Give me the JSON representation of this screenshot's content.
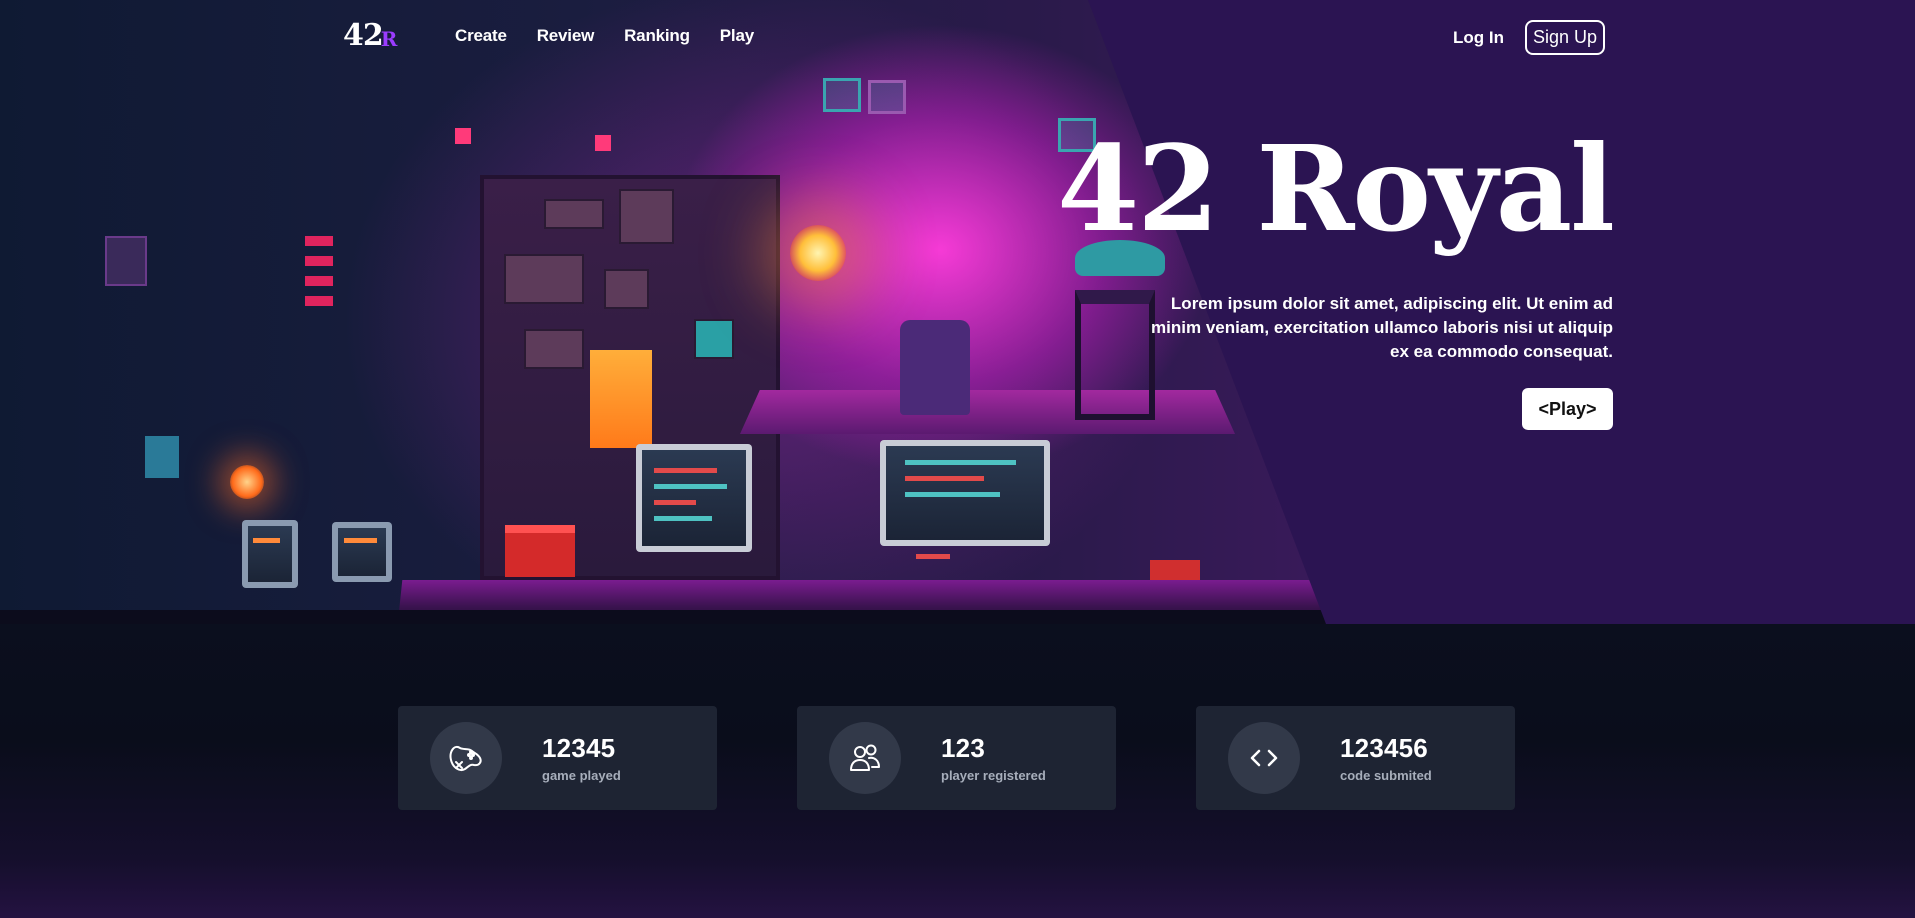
{
  "brand": {
    "logo_number": "42",
    "logo_letter": "R"
  },
  "nav": {
    "items": [
      {
        "label": "Create"
      },
      {
        "label": "Review"
      },
      {
        "label": "Ranking"
      },
      {
        "label": "Play"
      }
    ],
    "login_label": "Log In",
    "signup_label": "Sign Up"
  },
  "hero": {
    "title": "42 Royal",
    "description": "Lorem ipsum dolor sit amet, adipiscing elit. Ut enim ad minim veniam, exercitation ullamco laboris nisi ut aliquip ex ea commodo consequat.",
    "play_label": "<Play>"
  },
  "stats": [
    {
      "icon": "gamepad-icon",
      "value": "12345",
      "label": "game played"
    },
    {
      "icon": "users-icon",
      "value": "123",
      "label": "player registered"
    },
    {
      "icon": "code-icon",
      "value": "123456",
      "label": "code submited"
    }
  ],
  "colors": {
    "panel": "#2b1452",
    "accent": "#9a3cff",
    "stat_card": "#1e2433",
    "stat_circle": "#323949",
    "stat_label": "#a7aebb"
  }
}
